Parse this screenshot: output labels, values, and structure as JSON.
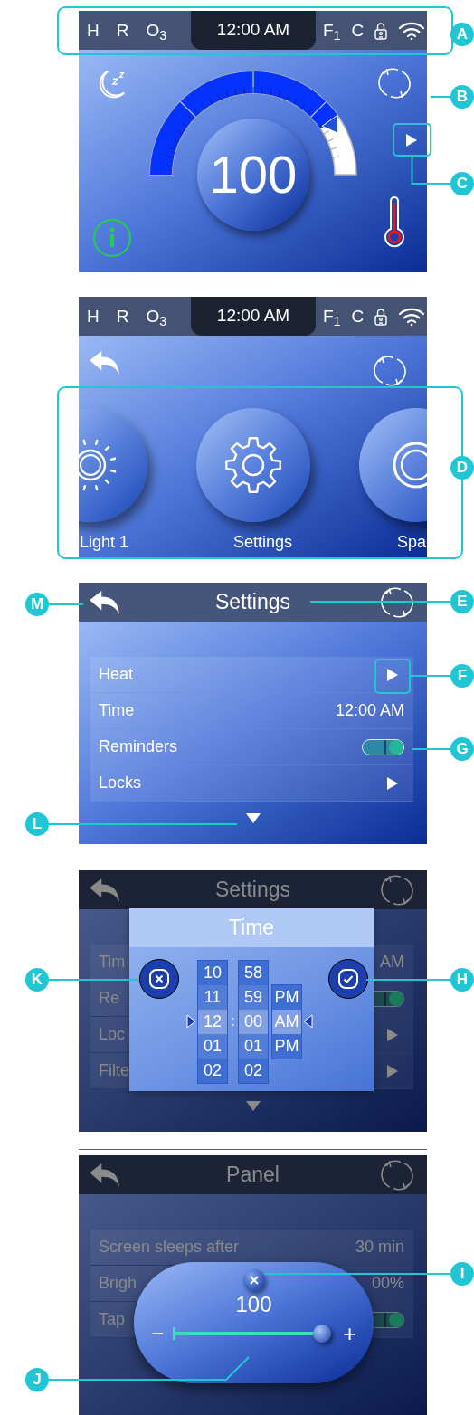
{
  "screens": [
    {
      "kind": "home",
      "status_bar": {
        "left": [
          "H",
          "R",
          "O$_{3}$"
        ],
        "time": "12:00 AM",
        "right": [
          "F$_{1}$",
          "C"
        ]
      },
      "gauge": {
        "value": "100"
      }
    },
    {
      "kind": "carousel",
      "status_bar": {
        "left": [
          "H",
          "R",
          "O$_{3}$"
        ],
        "time": "12:00 AM",
        "right": [
          "F$_{1}$",
          "C"
        ]
      },
      "items": [
        {
          "label": "Light 1",
          "kind": "sun"
        },
        {
          "label": "Settings",
          "kind": "gear"
        },
        {
          "label": "Spa",
          "kind": "ring"
        }
      ]
    },
    {
      "kind": "list",
      "title": "Settings",
      "dimmed": false,
      "rows": [
        {
          "label": "Heat",
          "kind": "link"
        },
        {
          "label": "Time",
          "kind": "value",
          "value": "12:00 AM"
        },
        {
          "label": "Reminders",
          "kind": "toggle",
          "on": true
        },
        {
          "label": "Locks",
          "kind": "link"
        }
      ]
    },
    {
      "kind": "list",
      "title": "Settings",
      "dimmed": true,
      "rows": [
        {
          "label": "Tim",
          "kind": "value",
          "value": "AM"
        },
        {
          "label": "Re",
          "kind": "toggle",
          "on": true
        },
        {
          "label": "Loc",
          "kind": "link"
        },
        {
          "label": "Filte",
          "kind": "link"
        }
      ],
      "dialog": {
        "kind": "time",
        "title": "Time",
        "separator": ":",
        "columns": [
          {
            "items": [
              {
                "label": "10",
                "selected": false
              },
              {
                "label": "11",
                "selected": false
              },
              {
                "label": "12",
                "selected": true
              },
              {
                "label": "01",
                "selected": false
              },
              {
                "label": "02",
                "selected": false
              }
            ]
          },
          {
            "items": [
              {
                "label": "58",
                "selected": false
              },
              {
                "label": "59",
                "selected": false
              },
              {
                "label": "00",
                "selected": true
              },
              {
                "label": "01",
                "selected": false
              },
              {
                "label": "02",
                "selected": false
              }
            ]
          },
          {
            "items": [
              {
                "label": "PM",
                "selected": false
              },
              {
                "label": "AM",
                "selected": true
              },
              {
                "label": "PM",
                "selected": false
              }
            ]
          }
        ]
      }
    },
    {
      "kind": "list",
      "title": "Panel",
      "dimmed": true,
      "rows": [
        {
          "label": "Screen sleeps after",
          "kind": "value",
          "value": "30 min"
        },
        {
          "label": "Brigh",
          "kind": "value",
          "value": "00%"
        },
        {
          "label": "Tap",
          "kind": "toggle",
          "on": true
        }
      ],
      "dialog": {
        "kind": "slider",
        "value": "100",
        "level": 0.97,
        "minus": "−",
        "plus": "+"
      }
    }
  ],
  "callouts": [
    {
      "letter": "A"
    },
    {
      "letter": "B"
    },
    {
      "letter": "C"
    },
    {
      "letter": "D"
    },
    {
      "letter": "M"
    },
    {
      "letter": "E"
    },
    {
      "letter": "F"
    },
    {
      "letter": "G"
    },
    {
      "letter": "L"
    },
    {
      "letter": "K"
    },
    {
      "letter": "H"
    },
    {
      "letter": "I"
    },
    {
      "letter": "J"
    }
  ]
}
